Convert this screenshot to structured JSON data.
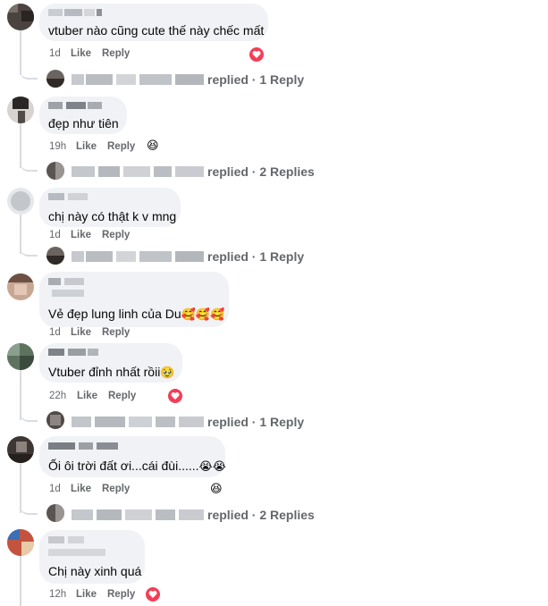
{
  "comments": [
    {
      "text": "vtuber nào cũng cute thế này chếc mất",
      "time": "1d",
      "like": "Like",
      "reply": "Reply",
      "replies": "replied · 1 Reply",
      "reaction": "heart"
    },
    {
      "text": "đẹp như tiên",
      "time": "19h",
      "like": "Like",
      "reply": "Reply",
      "replies": "replied · 2 Replies",
      "reaction": "haha"
    },
    {
      "text": "chị này có thật k v mng",
      "time": "1d",
      "like": "Like",
      "reply": "Reply",
      "replies": "replied · 1 Reply",
      "reaction": ""
    },
    {
      "text": "Vẻ đẹp lung linh của Du",
      "emojis": "🥰🥰🥰",
      "time": "1d",
      "like": "Like",
      "reply": "Reply",
      "replies": "",
      "reaction": ""
    },
    {
      "text": "Vtuber đỉnh nhất rồii",
      "emojis": "🥹",
      "time": "22h",
      "like": "Like",
      "reply": "Reply",
      "replies": "replied · 1 Reply",
      "reaction": "heart"
    },
    {
      "text": "Ối ôi trời đất ơi...cái đùi......",
      "emojis": "😭😭",
      "time": "1d",
      "like": "Like",
      "reply": "Reply",
      "replies": "replied · 2 Replies",
      "reaction": "haha"
    },
    {
      "text": "Chị này xinh quá",
      "time": "12h",
      "like": "Like",
      "reply": "Reply",
      "replies": "",
      "reaction": "heart"
    }
  ],
  "colors": {
    "bubble": "#f0f2f5",
    "meta": "#65676b",
    "text": "#050505",
    "heart": "#f33e58",
    "haha": "#f7b125"
  }
}
